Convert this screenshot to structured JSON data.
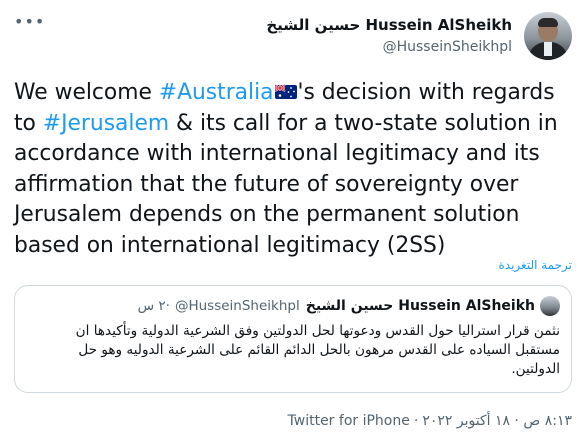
{
  "tweet": {
    "author_name": "حسين الشيخ Hussein AlSheikh",
    "author_handle": "@HusseinSheikhpl",
    "more_icon": "more-dots-icon",
    "text": {
      "part1": "We welcome ",
      "hashtag1": "#Australia",
      "flag": "australian-flag",
      "part2": "'s decision with regards to ",
      "hashtag2": "#Jerusalem",
      "part3": " & its call for a two-state solution in accordance with international legitimacy and its affirmation that the future of sovereignty over Jerusalem depends on the permanent solution based on international legitimacy (2SS)"
    },
    "translate_label": "ترجمة التغريدة",
    "timestamp": "٨:١٣ ص · ١٨ أكتوبر ٢٠٢٢",
    "source_separator": "·",
    "source": "Twitter for iPhone"
  },
  "quoted": {
    "author_name": "حسين الشيخ Hussein AlSheikh",
    "author_handle": "@HusseinSheikhpl",
    "separator": "·",
    "time_ago": "٢ س",
    "text": "نثمن قرار استراليا حول القدس ودعوتها لحل الدولتين وفق الشرعية الدولية وتأكيدها ان مستقبل السياده على القدس مرهون بالحل الدائم القائم على الشرعية الدوليه وهو حل الدولتين."
  },
  "colors": {
    "link": "#1d9bf0",
    "secondary_text": "#536471",
    "primary_text": "#0f1419",
    "border": "#cfd9de"
  }
}
